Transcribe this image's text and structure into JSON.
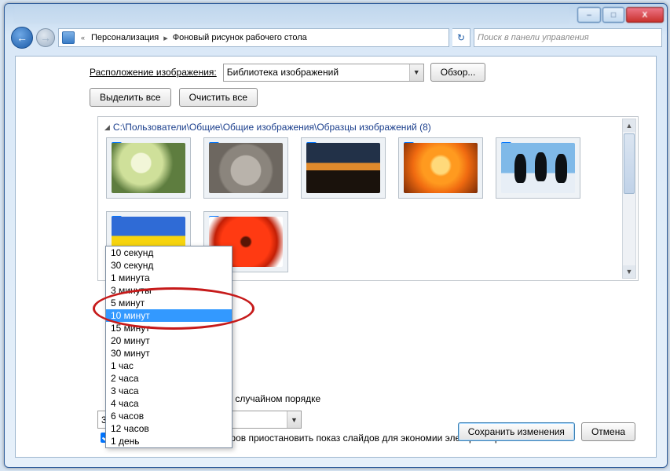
{
  "window": {
    "minimize": "–",
    "maximize": "□",
    "close": "X"
  },
  "nav": {
    "back": "←",
    "forward": "→",
    "quotes": "«",
    "crumb1": "Персонализация",
    "crumb2": "Фоновый рисунок рабочего стола",
    "refresh": "↻",
    "search_placeholder": "Поиск в панели управления"
  },
  "controls": {
    "location_label": "Расположение изображения:",
    "location_value": "Библиотека изображений",
    "browse": "Обзор...",
    "select_all": "Выделить все",
    "clear_all": "Очистить все"
  },
  "group": {
    "path": "C:\\Пользователи\\Общие\\Общие изображения\\Образцы изображений (8)"
  },
  "thumbs": [
    {
      "name": "hydrangea",
      "checked": true,
      "cls": "hydrangea"
    },
    {
      "name": "koala",
      "checked": true,
      "cls": "koala"
    },
    {
      "name": "lighthouse",
      "checked": true,
      "cls": "lighthouse"
    },
    {
      "name": "jellyfish",
      "checked": true,
      "cls": "jellyfish"
    },
    {
      "name": "penguins",
      "checked": true,
      "cls": "penguins"
    },
    {
      "name": "tulips",
      "checked": true,
      "cls": "tulips"
    },
    {
      "name": "gerbera",
      "checked": true,
      "cls": "gerbera"
    }
  ],
  "interval_options": [
    "10 секунд",
    "30 секунд",
    "1 минута",
    "3 минуты",
    "5 минут",
    "10 минут",
    "15 минут",
    "20 минут",
    "30 минут",
    "1 час",
    "2 часа",
    "3 часа",
    "4 часа",
    "6 часов",
    "12 часов",
    "1 день"
  ],
  "interval_selected_index": 5,
  "interval_current": "30 секунд",
  "checks": {
    "shuffle": "В случайном порядке",
    "battery": "При работе от аккумуляторов приостановить показ слайдов для экономии электроэнергии"
  },
  "buttons": {
    "save": "Сохранить изменения",
    "cancel": "Отмена"
  }
}
